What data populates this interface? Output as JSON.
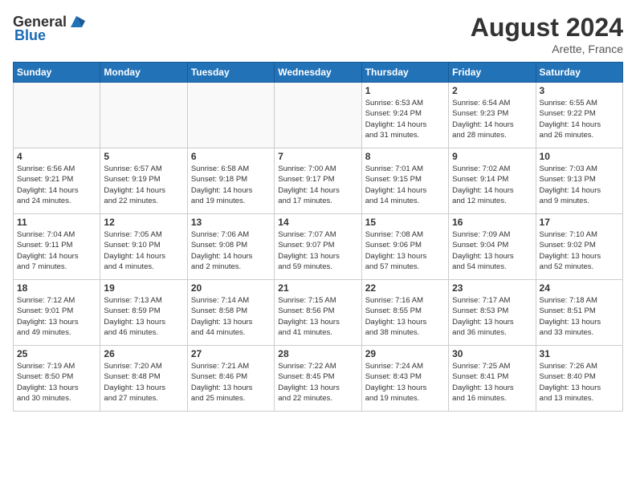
{
  "header": {
    "logo_general": "General",
    "logo_blue": "Blue",
    "month_year": "August 2024",
    "location": "Arette, France"
  },
  "weekdays": [
    "Sunday",
    "Monday",
    "Tuesday",
    "Wednesday",
    "Thursday",
    "Friday",
    "Saturday"
  ],
  "weeks": [
    [
      {
        "day": "",
        "info": ""
      },
      {
        "day": "",
        "info": ""
      },
      {
        "day": "",
        "info": ""
      },
      {
        "day": "",
        "info": ""
      },
      {
        "day": "1",
        "info": "Sunrise: 6:53 AM\nSunset: 9:24 PM\nDaylight: 14 hours\nand 31 minutes."
      },
      {
        "day": "2",
        "info": "Sunrise: 6:54 AM\nSunset: 9:23 PM\nDaylight: 14 hours\nand 28 minutes."
      },
      {
        "day": "3",
        "info": "Sunrise: 6:55 AM\nSunset: 9:22 PM\nDaylight: 14 hours\nand 26 minutes."
      }
    ],
    [
      {
        "day": "4",
        "info": "Sunrise: 6:56 AM\nSunset: 9:21 PM\nDaylight: 14 hours\nand 24 minutes."
      },
      {
        "day": "5",
        "info": "Sunrise: 6:57 AM\nSunset: 9:19 PM\nDaylight: 14 hours\nand 22 minutes."
      },
      {
        "day": "6",
        "info": "Sunrise: 6:58 AM\nSunset: 9:18 PM\nDaylight: 14 hours\nand 19 minutes."
      },
      {
        "day": "7",
        "info": "Sunrise: 7:00 AM\nSunset: 9:17 PM\nDaylight: 14 hours\nand 17 minutes."
      },
      {
        "day": "8",
        "info": "Sunrise: 7:01 AM\nSunset: 9:15 PM\nDaylight: 14 hours\nand 14 minutes."
      },
      {
        "day": "9",
        "info": "Sunrise: 7:02 AM\nSunset: 9:14 PM\nDaylight: 14 hours\nand 12 minutes."
      },
      {
        "day": "10",
        "info": "Sunrise: 7:03 AM\nSunset: 9:13 PM\nDaylight: 14 hours\nand 9 minutes."
      }
    ],
    [
      {
        "day": "11",
        "info": "Sunrise: 7:04 AM\nSunset: 9:11 PM\nDaylight: 14 hours\nand 7 minutes."
      },
      {
        "day": "12",
        "info": "Sunrise: 7:05 AM\nSunset: 9:10 PM\nDaylight: 14 hours\nand 4 minutes."
      },
      {
        "day": "13",
        "info": "Sunrise: 7:06 AM\nSunset: 9:08 PM\nDaylight: 14 hours\nand 2 minutes."
      },
      {
        "day": "14",
        "info": "Sunrise: 7:07 AM\nSunset: 9:07 PM\nDaylight: 13 hours\nand 59 minutes."
      },
      {
        "day": "15",
        "info": "Sunrise: 7:08 AM\nSunset: 9:06 PM\nDaylight: 13 hours\nand 57 minutes."
      },
      {
        "day": "16",
        "info": "Sunrise: 7:09 AM\nSunset: 9:04 PM\nDaylight: 13 hours\nand 54 minutes."
      },
      {
        "day": "17",
        "info": "Sunrise: 7:10 AM\nSunset: 9:02 PM\nDaylight: 13 hours\nand 52 minutes."
      }
    ],
    [
      {
        "day": "18",
        "info": "Sunrise: 7:12 AM\nSunset: 9:01 PM\nDaylight: 13 hours\nand 49 minutes."
      },
      {
        "day": "19",
        "info": "Sunrise: 7:13 AM\nSunset: 8:59 PM\nDaylight: 13 hours\nand 46 minutes."
      },
      {
        "day": "20",
        "info": "Sunrise: 7:14 AM\nSunset: 8:58 PM\nDaylight: 13 hours\nand 44 minutes."
      },
      {
        "day": "21",
        "info": "Sunrise: 7:15 AM\nSunset: 8:56 PM\nDaylight: 13 hours\nand 41 minutes."
      },
      {
        "day": "22",
        "info": "Sunrise: 7:16 AM\nSunset: 8:55 PM\nDaylight: 13 hours\nand 38 minutes."
      },
      {
        "day": "23",
        "info": "Sunrise: 7:17 AM\nSunset: 8:53 PM\nDaylight: 13 hours\nand 36 minutes."
      },
      {
        "day": "24",
        "info": "Sunrise: 7:18 AM\nSunset: 8:51 PM\nDaylight: 13 hours\nand 33 minutes."
      }
    ],
    [
      {
        "day": "25",
        "info": "Sunrise: 7:19 AM\nSunset: 8:50 PM\nDaylight: 13 hours\nand 30 minutes."
      },
      {
        "day": "26",
        "info": "Sunrise: 7:20 AM\nSunset: 8:48 PM\nDaylight: 13 hours\nand 27 minutes."
      },
      {
        "day": "27",
        "info": "Sunrise: 7:21 AM\nSunset: 8:46 PM\nDaylight: 13 hours\nand 25 minutes."
      },
      {
        "day": "28",
        "info": "Sunrise: 7:22 AM\nSunset: 8:45 PM\nDaylight: 13 hours\nand 22 minutes."
      },
      {
        "day": "29",
        "info": "Sunrise: 7:24 AM\nSunset: 8:43 PM\nDaylight: 13 hours\nand 19 minutes."
      },
      {
        "day": "30",
        "info": "Sunrise: 7:25 AM\nSunset: 8:41 PM\nDaylight: 13 hours\nand 16 minutes."
      },
      {
        "day": "31",
        "info": "Sunrise: 7:26 AM\nSunset: 8:40 PM\nDaylight: 13 hours\nand 13 minutes."
      }
    ]
  ]
}
